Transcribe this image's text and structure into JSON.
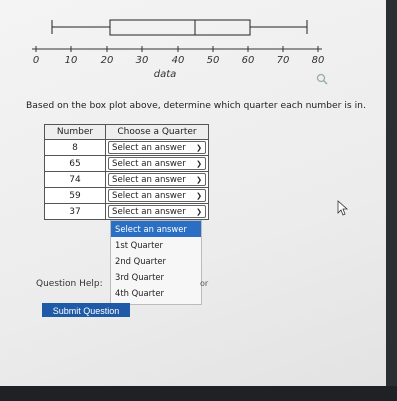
{
  "boxplot": {
    "axis_label": "data",
    "ticks": [
      "0",
      "10",
      "20",
      "30",
      "40",
      "50",
      "60",
      "70",
      "80"
    ]
  },
  "question_text": "Based on the box plot above, determine which quarter each number is in.",
  "table": {
    "headers": [
      "Number",
      "Choose a Quarter"
    ],
    "rows": [
      {
        "number": "8",
        "answer": "Select an answer"
      },
      {
        "number": "65",
        "answer": "Select an answer"
      },
      {
        "number": "74",
        "answer": "Select an answer"
      },
      {
        "number": "59",
        "answer": "Select an answer"
      },
      {
        "number": "37",
        "answer": "Select an answer"
      }
    ]
  },
  "dropdown": {
    "options": [
      "Select an answer",
      "1st Quarter",
      "2nd Quarter",
      "3rd Quarter",
      "4th Quarter"
    ]
  },
  "question_help": {
    "label": "Question Help:",
    "trailing": "or"
  },
  "submit_label": "Submit Question",
  "icons": {
    "zoom": "magnifier-icon",
    "cursor": "mouse-pointer-icon",
    "select": "chevron-down-icon"
  },
  "colors": {
    "submit": "#1e5aa6",
    "dropdown_highlight": "#2a6fc4"
  }
}
